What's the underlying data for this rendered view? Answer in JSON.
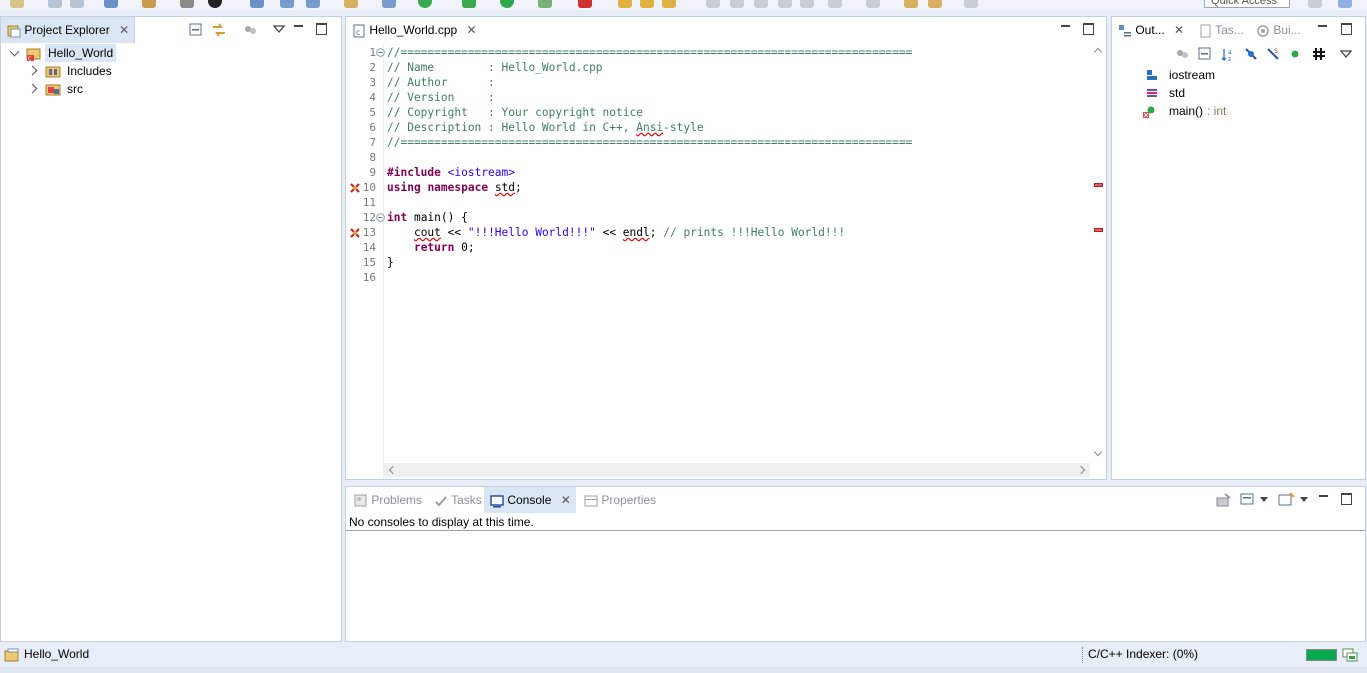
{
  "toolbar": {
    "quick_access": "Quick Access"
  },
  "explorer": {
    "tab_label": "Project Explorer",
    "tree": [
      {
        "label": "Hello_World",
        "icon": "cpp-project-icon",
        "expanded": true
      },
      {
        "label": "Includes",
        "icon": "includes-folder-icon"
      },
      {
        "label": "src",
        "icon": "source-folder-icon"
      }
    ]
  },
  "editor": {
    "tab_label": "Hello_World.cpp",
    "line_numbers": [
      "1",
      "2",
      "3",
      "4",
      "5",
      "6",
      "7",
      "8",
      "9",
      "10",
      "11",
      "12",
      "13",
      "14",
      "15",
      "16"
    ],
    "lines": {
      "l1": "//============================================================================",
      "l2": "// Name        : Hello_World.cpp",
      "l3": "// Author      :",
      "l4": "// Version     :",
      "l5": "// Copyright   : Your copyright notice",
      "l6a": "// Description : Hello World in C++, ",
      "l6b": "Ansi",
      "l6c": "-style",
      "l7": "//============================================================================",
      "l9a": "#include",
      "l9b": " <iostream>",
      "l10a": "using",
      "l10b": " ",
      "l10c": "namespace",
      "l10d": " ",
      "l10e": "std",
      "l10f": ";",
      "l12a": "int",
      "l12b": " main() {",
      "l13a": "    ",
      "l13b": "cout",
      "l13c": " << ",
      "l13d": "\"!!!Hello World!!!\"",
      "l13e": " << ",
      "l13f": "endl",
      "l13g": "; ",
      "l13h": "// prints !!!Hello World!!!",
      "l14a": "    ",
      "l14b": "return",
      "l14c": " 0;",
      "l15": "}"
    }
  },
  "outline": {
    "tabs": [
      {
        "label": "Out...",
        "icon": "outline-icon"
      },
      {
        "label": "Tas...",
        "icon": "task-list-icon"
      },
      {
        "label": "Bui...",
        "icon": "build-targets-icon"
      }
    ],
    "items": [
      {
        "label": "iostream",
        "icon": "include-icon"
      },
      {
        "label": "std",
        "icon": "namespace-icon"
      },
      {
        "label": "main()",
        "suffix": " : int",
        "icon": "function-error-icon"
      }
    ]
  },
  "console": {
    "tabs": [
      {
        "label": "Problems",
        "icon": "problems-icon"
      },
      {
        "label": "Tasks",
        "icon": "tasks-icon"
      },
      {
        "label": "Console",
        "icon": "console-icon"
      },
      {
        "label": "Properties",
        "icon": "properties-icon"
      }
    ],
    "message": "No consoles to display at this time."
  },
  "status": {
    "project": "Hello_World",
    "indexer": "C/C++ Indexer: (0%)",
    "progress_fraction": 1.0
  },
  "colors": {
    "keyword": "#7f0055",
    "comment": "#3f7f5f",
    "string": "#2a00ff",
    "error": "#e00000",
    "progress": "#0aa84f"
  }
}
